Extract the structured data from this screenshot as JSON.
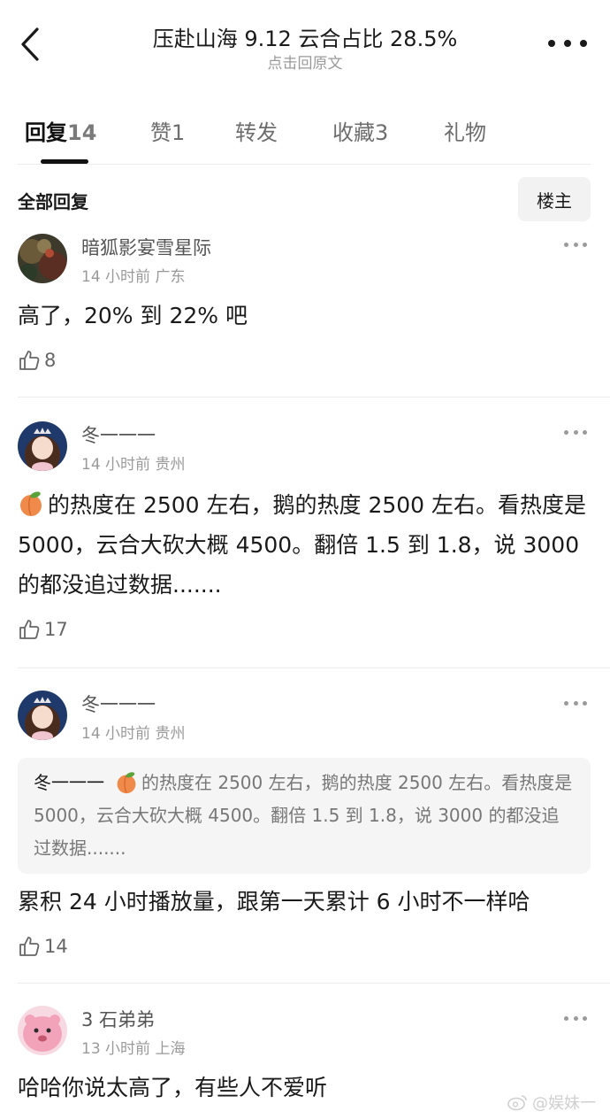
{
  "header": {
    "title": "压赴山海 9.12 云合占比 28.5%",
    "subtitle": "点击回原文",
    "back_icon": "chevron-left-icon",
    "more_icon": "more-horizontal-icon"
  },
  "tabs": [
    {
      "label": "回复",
      "count": "14",
      "active": true
    },
    {
      "label": "赞",
      "count": "1",
      "active": false
    },
    {
      "label": "转发",
      "count": "",
      "active": false
    },
    {
      "label": "收藏",
      "count": "3",
      "active": false
    },
    {
      "label": "礼物",
      "count": "",
      "active": false
    }
  ],
  "section": {
    "title": "全部回复",
    "filter_button": "楼主"
  },
  "comments": [
    {
      "name": "暗狐影宴雪星际",
      "time": "14 小时前",
      "location": "广东",
      "text": "高了，20% 到 22% 吧",
      "likes": "8"
    },
    {
      "name": "冬一一一",
      "time": "14 小时前",
      "location": "贵州",
      "text_after_emoji": "的热度在 2500 左右，鹅的热度 2500 左右。看热度是 5000，云合大砍大概 4500。翻倍 1.5 到 1.8，说 3000 的都没追过数据.......",
      "likes": "17"
    },
    {
      "name": "冬一一一",
      "time": "14 小时前",
      "location": "贵州",
      "quote_name": "冬一一一",
      "quote_text": "的热度在 2500 左右，鹅的热度 2500 左右。看热度是 5000，云合大砍大概 4500。翻倍 1.5 到 1.8，说 3000 的都没追过数据.......",
      "text": "累积 24 小时播放量，跟第一天累计 6 小时不一样哈",
      "likes": "14"
    },
    {
      "name": "3 石弟弟",
      "time": "13 小时前",
      "location": "上海",
      "text": "哈哈你说太高了，有些人不爱听"
    }
  ],
  "watermark": "@娱妹一",
  "colors": {
    "text": "#1a1a1a",
    "muted": "#9a9a9a",
    "divider": "#ececec",
    "quote_bg": "#f5f5f5"
  }
}
